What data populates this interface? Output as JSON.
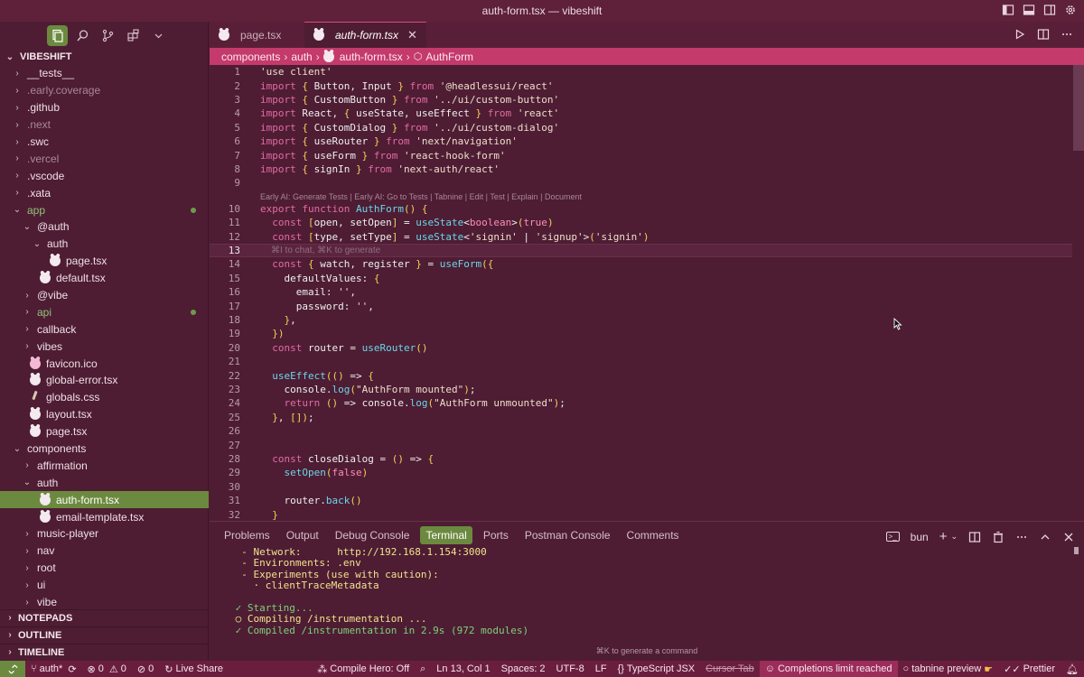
{
  "window": {
    "title": "auth-form.tsx — vibeshift"
  },
  "colors": {
    "accent_green": "#6c8a3f",
    "accent_pink": "#c33a6b",
    "background": "#4e1d33",
    "status_bar": "#6a1e3d"
  },
  "activity_bar": [
    "files-icon",
    "search-icon",
    "source-control-icon",
    "extensions-icon",
    "chevron-down-icon"
  ],
  "explorer": {
    "root": "VIBESHIFT",
    "items": [
      {
        "label": "__tests__",
        "kind": "folder",
        "depth": 1,
        "open": false
      },
      {
        "label": ".early.coverage",
        "kind": "folder",
        "depth": 1,
        "open": false,
        "dim": true
      },
      {
        "label": ".github",
        "kind": "folder",
        "depth": 1,
        "open": false
      },
      {
        "label": ".next",
        "kind": "folder",
        "depth": 1,
        "open": false,
        "dim": true
      },
      {
        "label": ".swc",
        "kind": "folder",
        "depth": 1,
        "open": false
      },
      {
        "label": ".vercel",
        "kind": "folder",
        "depth": 1,
        "open": false,
        "dim": true
      },
      {
        "label": ".vscode",
        "kind": "folder",
        "depth": 1,
        "open": false
      },
      {
        "label": ".xata",
        "kind": "folder",
        "depth": 1,
        "open": false
      },
      {
        "label": "app",
        "kind": "folder",
        "depth": 1,
        "open": true,
        "green": true,
        "dot": true
      },
      {
        "label": "@auth",
        "kind": "folder",
        "depth": 2,
        "open": true
      },
      {
        "label": "auth",
        "kind": "folder",
        "depth": 3,
        "open": true
      },
      {
        "label": "page.tsx",
        "kind": "file",
        "depth": 4
      },
      {
        "label": "default.tsx",
        "kind": "file",
        "depth": 3
      },
      {
        "label": "@vibe",
        "kind": "folder",
        "depth": 2,
        "open": false
      },
      {
        "label": "api",
        "kind": "folder",
        "depth": 2,
        "open": false,
        "green": true,
        "dot": true
      },
      {
        "label": "callback",
        "kind": "folder",
        "depth": 2,
        "open": false
      },
      {
        "label": "vibes",
        "kind": "folder",
        "depth": 2,
        "open": false
      },
      {
        "label": "favicon.ico",
        "kind": "file",
        "depth": 2,
        "icon": "pink"
      },
      {
        "label": "global-error.tsx",
        "kind": "file",
        "depth": 2
      },
      {
        "label": "globals.css",
        "kind": "file",
        "depth": 2,
        "icon": "brush"
      },
      {
        "label": "layout.tsx",
        "kind": "file",
        "depth": 2
      },
      {
        "label": "page.tsx",
        "kind": "file",
        "depth": 2
      },
      {
        "label": "components",
        "kind": "folder",
        "depth": 1,
        "open": true
      },
      {
        "label": "affirmation",
        "kind": "folder",
        "depth": 2,
        "open": false
      },
      {
        "label": "auth",
        "kind": "folder",
        "depth": 2,
        "open": true
      },
      {
        "label": "auth-form.tsx",
        "kind": "file",
        "depth": 3,
        "selected": true
      },
      {
        "label": "email-template.tsx",
        "kind": "file",
        "depth": 3
      },
      {
        "label": "music-player",
        "kind": "folder",
        "depth": 2,
        "open": false
      },
      {
        "label": "nav",
        "kind": "folder",
        "depth": 2,
        "open": false
      },
      {
        "label": "root",
        "kind": "folder",
        "depth": 2,
        "open": false
      },
      {
        "label": "ui",
        "kind": "folder",
        "depth": 2,
        "open": false
      },
      {
        "label": "vibe",
        "kind": "folder",
        "depth": 2,
        "open": false
      }
    ],
    "sections": [
      "NOTEPADS",
      "OUTLINE",
      "TIMELINE"
    ]
  },
  "tabs": [
    {
      "label": "page.tsx",
      "active": false
    },
    {
      "label": "auth-form.tsx",
      "active": true,
      "close": "✕"
    }
  ],
  "breadcrumb": [
    "components",
    "auth",
    "auth-form.tsx",
    "AuthForm"
  ],
  "code": {
    "lens": "Early AI: Generate Tests | Early AI: Go to Tests | Tabnine | Edit | Test | Explain | Document",
    "ghost": "⌘I to chat, ⌘K to generate",
    "lines": [
      {
        "n": "1",
        "text": "'use client'"
      },
      {
        "n": "2",
        "text": "import { Button, Input } from '@headlessui/react'"
      },
      {
        "n": "3",
        "text": "import { CustomButton } from '../ui/custom-button'"
      },
      {
        "n": "4",
        "text": "import React, { useState, useEffect } from 'react'"
      },
      {
        "n": "5",
        "text": "import { CustomDialog } from '../ui/custom-dialog'"
      },
      {
        "n": "6",
        "text": "import { useRouter } from 'next/navigation'"
      },
      {
        "n": "7",
        "text": "import { useForm } from 'react-hook-form'"
      },
      {
        "n": "8",
        "text": "import { signIn } from 'next-auth/react'"
      },
      {
        "n": "9",
        "text": ""
      },
      {
        "n": "10",
        "text": "export function AuthForm() {"
      },
      {
        "n": "11",
        "text": "  const [open, setOpen] = useState<boolean>(true)"
      },
      {
        "n": "12",
        "text": "  const [type, setType] = useState<'signin' | 'signup'>('signin')"
      },
      {
        "n": "13",
        "text": ""
      },
      {
        "n": "14",
        "text": "  const { watch, register } = useForm({"
      },
      {
        "n": "15",
        "text": "    defaultValues: {"
      },
      {
        "n": "16",
        "text": "      email: '',"
      },
      {
        "n": "17",
        "text": "      password: '',"
      },
      {
        "n": "18",
        "text": "    },"
      },
      {
        "n": "19",
        "text": "  })"
      },
      {
        "n": "20",
        "text": "  const router = useRouter()"
      },
      {
        "n": "21",
        "text": ""
      },
      {
        "n": "22",
        "text": "  useEffect(() => {"
      },
      {
        "n": "23",
        "text": "    console.log(\"AuthForm mounted\");"
      },
      {
        "n": "24",
        "text": "    return () => console.log(\"AuthForm unmounted\");"
      },
      {
        "n": "25",
        "text": "  }, []);"
      },
      {
        "n": "26",
        "text": ""
      },
      {
        "n": "27",
        "text": ""
      },
      {
        "n": "28",
        "text": "  const closeDialog = () => {"
      },
      {
        "n": "29",
        "text": "    setOpen(false)"
      },
      {
        "n": "30",
        "text": ""
      },
      {
        "n": "31",
        "text": "    router.back()"
      },
      {
        "n": "32",
        "text": "  }"
      }
    ]
  },
  "panel": {
    "tabs": [
      "Problems",
      "Output",
      "Debug Console",
      "Terminal",
      "Ports",
      "Postman Console",
      "Comments"
    ],
    "active_tab": "Terminal",
    "shell": "bun",
    "terminal_lines": [
      "  - Network:      http://192.168.1.154:3000",
      "  - Environments: .env",
      "  - Experiments (use with caution):",
      "    · clientTraceMetadata",
      "",
      " ✓ Starting...",
      " ○ Compiling /instrumentation ...",
      " ✓ Compiled /instrumentation in 2.9s (972 modules)"
    ],
    "hint": "⌘K to generate a command"
  },
  "statusbar": {
    "branch": "auth*",
    "errors": "0",
    "warnings": "0",
    "ports": "0",
    "live_share": "Live Share",
    "compile_hero": "Compile Hero: Off",
    "position": "Ln 13, Col 1",
    "spaces": "Spaces: 2",
    "encoding": "UTF-8",
    "eol": "LF",
    "language": "TypeScript JSX",
    "cursor_tab": "Cursor Tab",
    "completions": "Completions limit reached",
    "tabnine": "tabnine preview",
    "prettier": "Prettier"
  }
}
